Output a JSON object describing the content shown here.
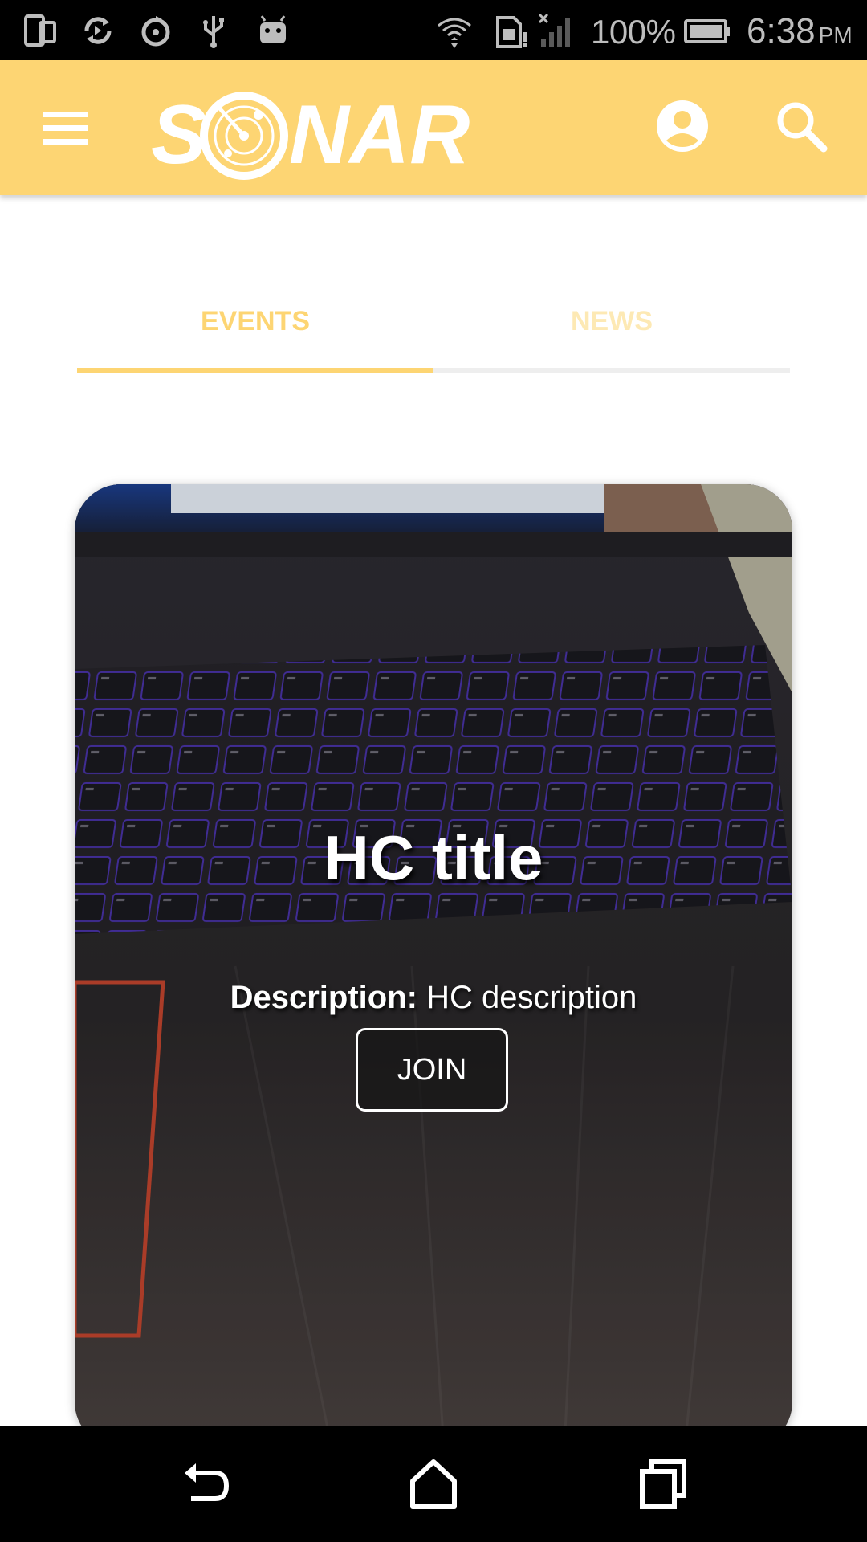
{
  "status_bar": {
    "battery_percent": "100%",
    "time": "6:38",
    "ampm": "PM",
    "icons": [
      "phone-icon",
      "sync-icon",
      "loading-icon",
      "usb-icon",
      "android-icon",
      "wifi-icon",
      "sim-icon",
      "signal-icon",
      "battery-icon"
    ]
  },
  "app_bar": {
    "logo_text": "SONAR",
    "brand_color": "#fdd573"
  },
  "tabs": [
    {
      "label": "EVENTS",
      "selected": true
    },
    {
      "label": "NEWS",
      "selected": false
    }
  ],
  "event_card": {
    "title": "HC title",
    "description_label": "Description:",
    "description": "HC description",
    "join_label": "JOIN"
  },
  "nav_bar": {
    "icons": [
      "back-icon",
      "home-icon",
      "recents-icon"
    ]
  }
}
